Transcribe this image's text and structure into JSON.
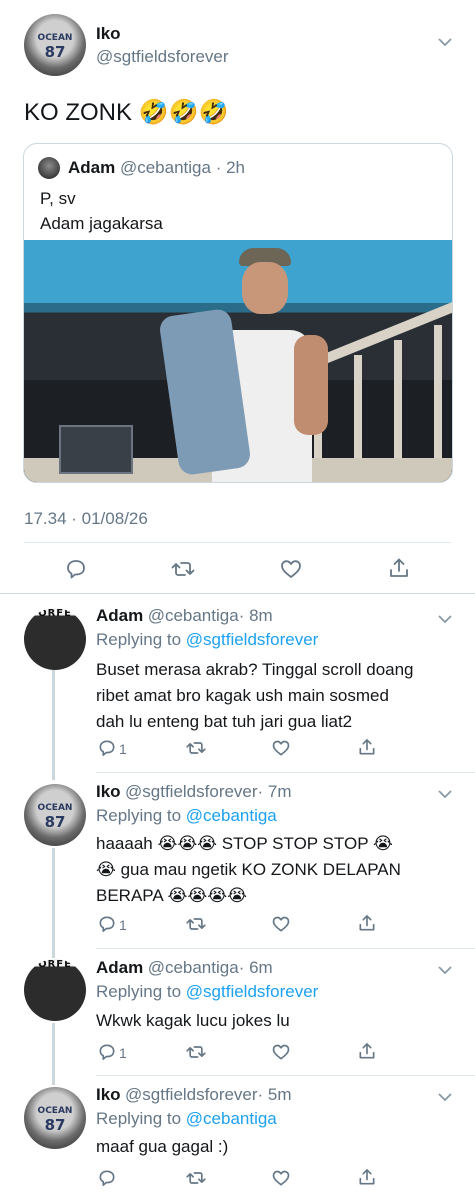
{
  "main_tweet": {
    "author_name": "Iko",
    "author_handle": "@sgtfieldsforever",
    "avatar_jersey_text": "OCEAN",
    "avatar_jersey_number": "87",
    "text": "KO ZONK 🤣🤣🤣",
    "timestamp": "17.34 · 01/08/26"
  },
  "quoted_tweet": {
    "author_name": "Adam",
    "author_handle": "@cebantiga",
    "time": "· 2h",
    "line1": "P, sv",
    "line2": "Adam jagakarsa"
  },
  "replies": [
    {
      "author_name": "Adam",
      "author_handle": "@cebantiga",
      "time": "· 8m",
      "replying_prefix": "Replying to ",
      "replying_to": "@sgtfieldsforever",
      "lines": [
        "Buset merasa akrab? Tinggal scroll doang",
        "ribet amat bro kagak ush main sosmed",
        "dah lu enteng bat tuh jari gua liat2"
      ],
      "reply_count": "1",
      "avatar_text": "ORFE"
    },
    {
      "author_name": "Iko",
      "author_handle": "@sgtfieldsforever",
      "time": "· 7m",
      "replying_prefix": "Replying to ",
      "replying_to": "@cebantiga",
      "lines": [
        "haaaah 😭😭😭 STOP STOP STOP 😭",
        "😭 gua mau ngetik KO ZONK DELAPAN",
        "BERAPA 😭😭😭😭"
      ],
      "reply_count": "1",
      "avatar_text": "OCEAN",
      "avatar_number": "87"
    },
    {
      "author_name": "Adam",
      "author_handle": "@cebantiga",
      "time": "· 6m",
      "replying_prefix": "Replying to ",
      "replying_to": "@sgtfieldsforever",
      "lines": [
        "Wkwk kagak lucu jokes lu"
      ],
      "reply_count": "1",
      "avatar_text": "ORFE"
    },
    {
      "author_name": "Iko",
      "author_handle": "@sgtfieldsforever",
      "time": "· 5m",
      "replying_prefix": "Replying to ",
      "replying_to": "@cebantiga",
      "lines": [
        "maaf gua gagal :)"
      ],
      "reply_count": "",
      "avatar_text": "OCEAN",
      "avatar_number": "87"
    }
  ],
  "icons": {
    "chevron": "chevron-down-icon",
    "reply": "reply-icon",
    "retweet": "retweet-icon",
    "like": "heart-icon",
    "share": "share-icon"
  },
  "colors": {
    "link": "#1da1f2",
    "muted": "#657786",
    "divider": "#e1e8ed"
  }
}
